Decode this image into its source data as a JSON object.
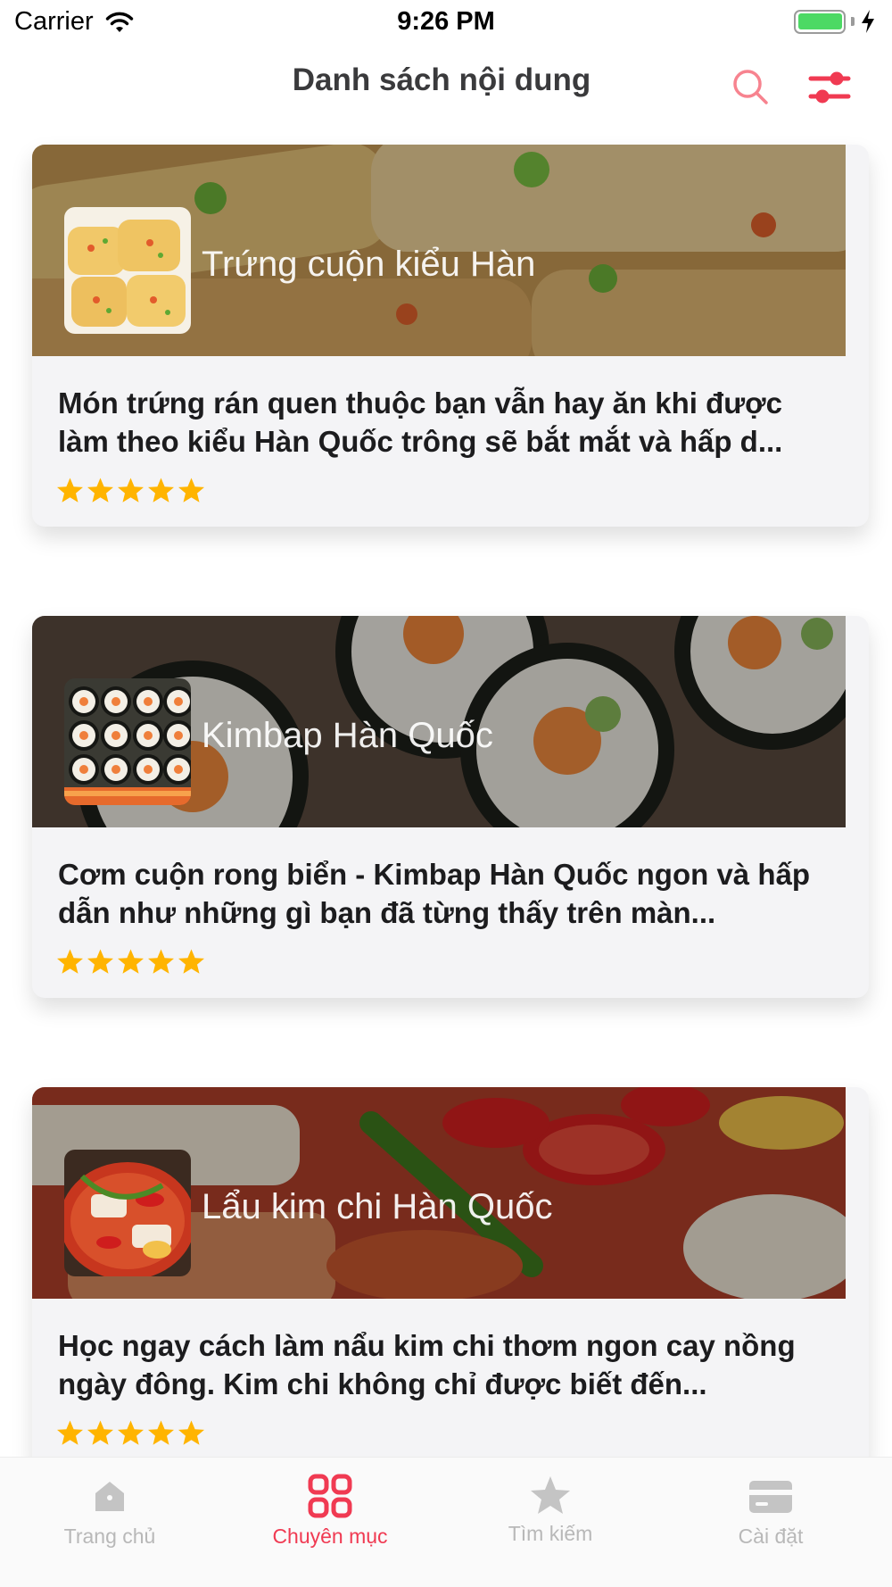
{
  "status_bar": {
    "carrier": "Carrier",
    "time": "9:26 PM",
    "battery_level": 1.0
  },
  "nav": {
    "title": "Danh sách nội dung",
    "search_icon": "search-icon",
    "filter_icon": "sliders-icon"
  },
  "items": [
    {
      "title": "Trứng cuộn kiểu Hàn",
      "description": "Món trứng rán quen thuộc bạn vẫn hay ăn khi được làm theo kiểu Hàn Quốc trông sẽ bắt mắt và hấp d...",
      "rating": 5,
      "image": "rolled-omelette"
    },
    {
      "title": "Kimbap Hàn Quốc",
      "description": "Cơm cuộn rong biển - Kimbap Hàn Quốc ngon và hấp dẫn như những gì bạn đã từng thấy trên màn...",
      "rating": 5,
      "image": "kimbap"
    },
    {
      "title": "Lẩu kim chi Hàn Quốc",
      "description": "Học ngay cách làm nẩu kim chi thơm ngon cay nồng ngày đông. Kim chi không chỉ được biết đến...",
      "rating": 5,
      "image": "kimchi-hotpot"
    }
  ],
  "tabs": [
    {
      "label": "Trang chủ",
      "icon": "home-icon",
      "active": false
    },
    {
      "label": "Chuyên mục",
      "icon": "grid-icon",
      "active": true
    },
    {
      "label": "Tìm kiếm",
      "icon": "star-icon",
      "active": false
    },
    {
      "label": "Cài đặt",
      "icon": "card-icon",
      "active": false
    }
  ],
  "colors": {
    "accent": "#f03a52",
    "star": "#ffb400",
    "tab_inactive": "#b8b8b8"
  }
}
